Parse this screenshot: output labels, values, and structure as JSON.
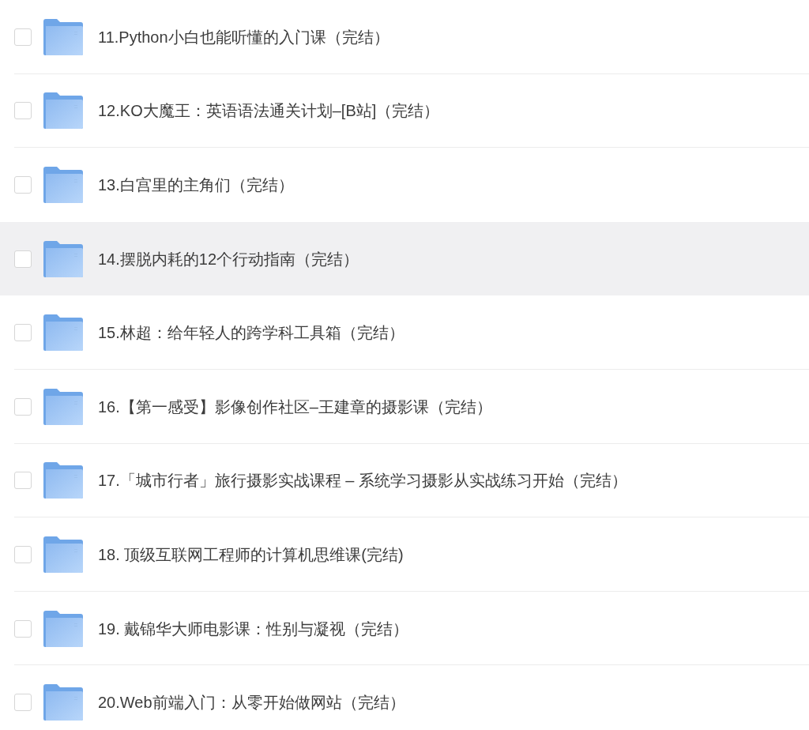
{
  "items": [
    {
      "name": "11.Python小白也能听懂的入门课（完结）",
      "checked": false,
      "highlighted": false
    },
    {
      "name": "12.KO大魔王：英语语法通关计划–[B站]（完结）",
      "checked": false,
      "highlighted": false
    },
    {
      "name": "13.白宫里的主角们（完结）",
      "checked": false,
      "highlighted": false
    },
    {
      "name": "14.摆脱内耗的12个行动指南（完结）",
      "checked": false,
      "highlighted": true
    },
    {
      "name": "15.林超：给年轻人的跨学科工具箱（完结）",
      "checked": false,
      "highlighted": false
    },
    {
      "name": "16.【第一感受】影像创作社区–王建章的摄影课（完结）",
      "checked": false,
      "highlighted": false
    },
    {
      "name": "17.「城市行者」旅行摄影实战课程 – 系统学习摄影从实战练习开始（完结）",
      "checked": false,
      "highlighted": false
    },
    {
      "name": "18. 顶级互联网工程师的计算机思维课(完结)",
      "checked": false,
      "highlighted": false
    },
    {
      "name": "19. 戴锦华大师电影课：性别与凝视（完结）",
      "checked": false,
      "highlighted": false
    },
    {
      "name": "20.Web前端入门：从零开始做网站（完结）",
      "checked": false,
      "highlighted": false
    }
  ]
}
